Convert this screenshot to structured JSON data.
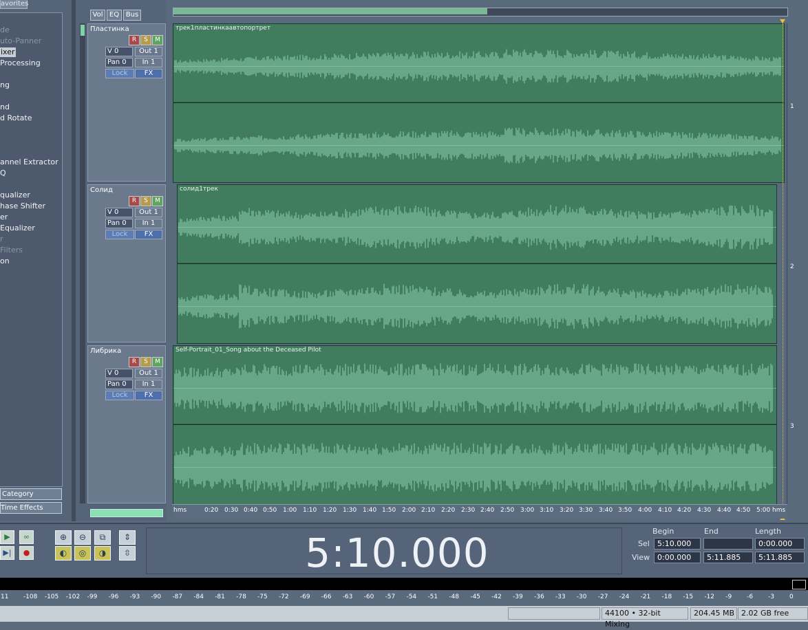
{
  "left_panel": {
    "tab": "avorites",
    "items": [
      {
        "label": "de",
        "dim": true
      },
      {
        "label": "uto-Panner",
        "dim": true
      },
      {
        "label": "ixer",
        "sel": true
      },
      {
        "label": "Processing"
      },
      {
        "label": "ng"
      },
      {
        "label": "nd"
      },
      {
        "label": "d Rotate"
      },
      {
        "label": "annel Extractor"
      },
      {
        "label": "Q"
      },
      {
        "label": "qualizer"
      },
      {
        "label": "hase Shifter"
      },
      {
        "label": "er"
      },
      {
        "label": " Equalizer"
      },
      {
        "label": "r",
        "dim": true
      },
      {
        "label": "Filters",
        "dim": true
      },
      {
        "label": "on"
      }
    ],
    "btn_category": "Category",
    "btn_time": "Time Effects"
  },
  "tabs": {
    "vol": "Vol",
    "eq": "EQ",
    "bus": "Bus"
  },
  "tracks": [
    {
      "name": "Пластинка",
      "vol": "V 0",
      "out": "Out 1",
      "pan": "Pan 0",
      "in": "In 1",
      "lock": "Lock",
      "fx": "FX",
      "r": "R",
      "s": "S",
      "m": "M"
    },
    {
      "name": "Солид",
      "vol": "V 0",
      "out": "Out 1",
      "pan": "Pan 0",
      "in": "In 1",
      "lock": "Lock",
      "fx": "FX",
      "r": "R",
      "s": "S",
      "m": "M"
    },
    {
      "name": "Либрика",
      "vol": "V 0",
      "out": "Out 1",
      "pan": "Pan 0",
      "in": "In 1",
      "lock": "Lock",
      "fx": "FX",
      "r": "R",
      "s": "S",
      "m": "M"
    }
  ],
  "clips": [
    {
      "title": "трек1пластинкаавтопортрет",
      "num": "1"
    },
    {
      "title": "солид1трек",
      "num": "2"
    },
    {
      "title": "Self-Portrait_01_Song about the Deceased Pilot",
      "num": "3"
    }
  ],
  "ruler": [
    "hms",
    "0:20",
    "0:30",
    "0:40",
    "0:50",
    "1:00",
    "1:10",
    "1:20",
    "1:30",
    "1:40",
    "1:50",
    "2:00",
    "2:10",
    "2:20",
    "2:30",
    "2:40",
    "2:50",
    "3:00",
    "3:10",
    "3:20",
    "3:30",
    "3:40",
    "3:50",
    "4:00",
    "4:10",
    "4:20",
    "4:30",
    "4:40",
    "4:50",
    "5:00",
    "hms"
  ],
  "time": "5:10.000",
  "selection": {
    "begin_label": "Begin",
    "end_label": "End",
    "length_label": "Length",
    "sel_label": "Sel",
    "view_label": "View",
    "sel_begin": "5:10.000",
    "sel_end": "",
    "sel_length": "0:00.000",
    "view_begin": "0:00.000",
    "view_end": "5:11.885",
    "view_length": "5:11.885"
  },
  "vu_scale": [
    "11",
    "-108",
    "-105",
    "-102",
    "-99",
    "-96",
    "-93",
    "-90",
    "-87",
    "-84",
    "-81",
    "-78",
    "-75",
    "-72",
    "-69",
    "-66",
    "-63",
    "-60",
    "-57",
    "-54",
    "-51",
    "-48",
    "-45",
    "-42",
    "-39",
    "-36",
    "-33",
    "-30",
    "-27",
    "-24",
    "-21",
    "-18",
    "-15",
    "-12",
    "-9",
    "-6",
    "-3",
    "0"
  ],
  "status": {
    "rate": "44100 • 32-bit Mixing",
    "mem": "204.45 MB",
    "disk": "2.02 GB free"
  },
  "colors": {
    "clip": "#417c5f",
    "wave": "#79b99a",
    "accent": "#8ce0b6"
  }
}
